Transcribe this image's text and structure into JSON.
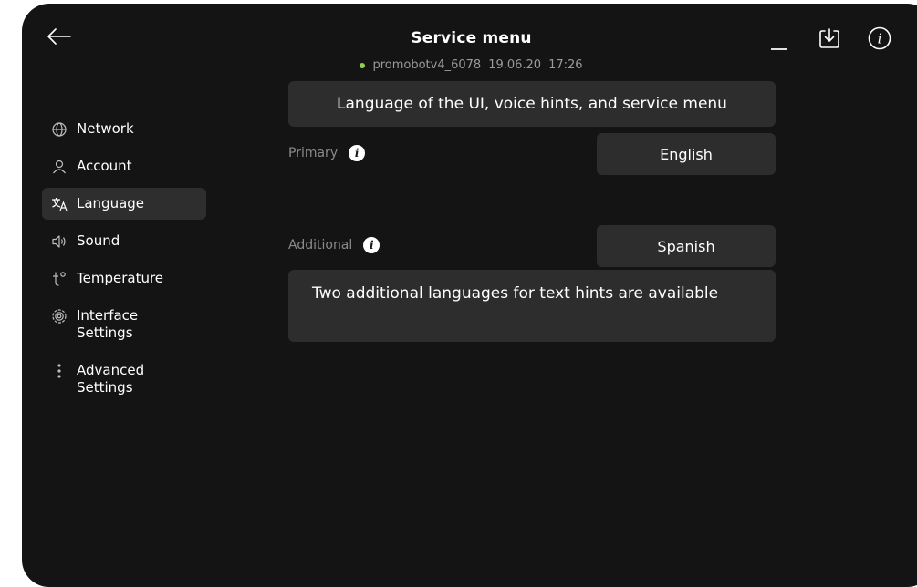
{
  "header": {
    "title": "Service menu",
    "device": "promobotv4_6078",
    "date": "19.06.20",
    "time": "17:26",
    "status_color": "#8fd14f"
  },
  "toolbar": {
    "back_icon": "arrow-left-icon",
    "minimize_label": "_",
    "download_icon": "download-icon",
    "info_icon": "info-icon"
  },
  "sidebar": {
    "items": [
      {
        "label": "Network",
        "icon": "globe-icon"
      },
      {
        "label": "Account",
        "icon": "user-icon"
      },
      {
        "label": "Language",
        "icon": "translate-icon",
        "active": true
      },
      {
        "label": "Sound",
        "icon": "speaker-icon"
      },
      {
        "label": "Temperature",
        "icon": "thermometer-icon"
      },
      {
        "label": "Interface\nSettings",
        "icon": "settings-icon"
      },
      {
        "label": "Advanced\nSettings",
        "icon": "more-vertical-icon"
      }
    ]
  },
  "main": {
    "header": "Language of the UI, voice hints, and service menu",
    "primary": {
      "label": "Primary",
      "value": "English"
    },
    "additional": {
      "label": "Additional",
      "value": "Spanish"
    },
    "note": "Two additional languages for text hints are available"
  }
}
